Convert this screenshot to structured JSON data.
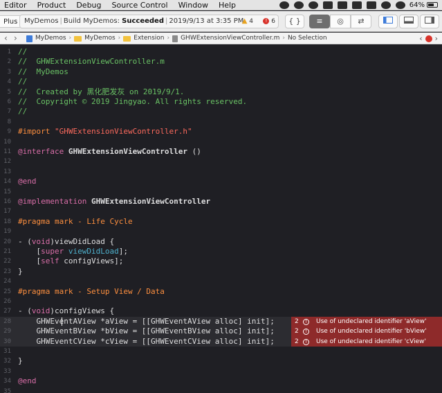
{
  "menubar": {
    "items": [
      "Editor",
      "Product",
      "Debug",
      "Source Control",
      "Window",
      "Help"
    ],
    "battery": "64%"
  },
  "toolbar": {
    "scheme": "Plus",
    "activity": {
      "project": "MyDemos",
      "action": "Build MyDemos:",
      "status": "Succeeded",
      "timestamp": "2019/9/13 at 3:35 PM",
      "warnings": "4",
      "errors": "6"
    },
    "buttons": {
      "braces": "{ }",
      "standard_editor": "≡",
      "assistant_editor": "◎",
      "version_editor": "⇄"
    }
  },
  "jumpbar": {
    "crumbs": [
      "MyDemos",
      "MyDemos",
      "Extension",
      "GHWExtensionViewController.m",
      "No Selection"
    ]
  },
  "editor": {
    "lines": [
      {
        "n": "1",
        "segs": [
          [
            "comment",
            "//"
          ]
        ]
      },
      {
        "n": "2",
        "segs": [
          [
            "comment",
            "//  GHWExtensionViewController.m"
          ]
        ]
      },
      {
        "n": "3",
        "segs": [
          [
            "comment",
            "//  MyDemos"
          ]
        ]
      },
      {
        "n": "4",
        "segs": [
          [
            "comment",
            "//"
          ]
        ]
      },
      {
        "n": "5",
        "segs": [
          [
            "comment",
            "//  Created by 黑化肥发灰 on 2019/9/1."
          ]
        ]
      },
      {
        "n": "6",
        "segs": [
          [
            "comment",
            "//  Copyright © 2019 Jingyao. All rights reserved."
          ]
        ]
      },
      {
        "n": "7",
        "segs": [
          [
            "comment",
            "//"
          ]
        ]
      },
      {
        "n": "8",
        "segs": []
      },
      {
        "n": "9",
        "segs": [
          [
            "preproc",
            "#import "
          ],
          [
            "string",
            "\"GHWExtensionViewController.h\""
          ]
        ]
      },
      {
        "n": "10",
        "segs": []
      },
      {
        "n": "11",
        "segs": [
          [
            "keyword",
            "@interface "
          ],
          [
            "classname",
            "GHWExtensionViewController"
          ],
          [
            "plain",
            " ()"
          ]
        ]
      },
      {
        "n": "12",
        "segs": []
      },
      {
        "n": "13",
        "segs": []
      },
      {
        "n": "14",
        "segs": [
          [
            "keyword",
            "@end"
          ]
        ]
      },
      {
        "n": "15",
        "segs": []
      },
      {
        "n": "16",
        "segs": [
          [
            "keyword",
            "@implementation "
          ],
          [
            "classname",
            "GHWExtensionViewController"
          ]
        ]
      },
      {
        "n": "17",
        "segs": []
      },
      {
        "n": "18",
        "segs": [
          [
            "preproc",
            "#pragma mark - Life Cycle"
          ]
        ]
      },
      {
        "n": "19",
        "segs": []
      },
      {
        "n": "20",
        "segs": [
          [
            "plain",
            "- ("
          ],
          [
            "keyword",
            "void"
          ],
          [
            "plain",
            ")viewDidLoad {"
          ]
        ]
      },
      {
        "n": "21",
        "segs": [
          [
            "plain",
            "    ["
          ],
          [
            "keyword",
            "super "
          ],
          [
            "method",
            "viewDidLoad"
          ],
          [
            "plain",
            "];"
          ]
        ]
      },
      {
        "n": "22",
        "segs": [
          [
            "plain",
            "    ["
          ],
          [
            "keyword",
            "self "
          ],
          [
            "plain",
            "configViews];"
          ]
        ]
      },
      {
        "n": "23",
        "segs": [
          [
            "plain",
            "}"
          ]
        ]
      },
      {
        "n": "24",
        "segs": []
      },
      {
        "n": "25",
        "segs": [
          [
            "preproc",
            "#pragma mark - Setup View / Data"
          ]
        ]
      },
      {
        "n": "26",
        "segs": []
      },
      {
        "n": "27",
        "segs": [
          [
            "plain",
            "- ("
          ],
          [
            "keyword",
            "void"
          ],
          [
            "plain",
            ")configViews {"
          ]
        ]
      },
      {
        "n": "28",
        "hl": true,
        "segs": [
          [
            "plain",
            "    GHWEventAView *aView = [[GHWEventAView alloc] init];"
          ]
        ],
        "error": {
          "count": "2",
          "msg": "Use of undeclared identifier 'aView'"
        }
      },
      {
        "n": "29",
        "hl": true,
        "segs": [
          [
            "plain",
            "    GHWEventBView *bView = [[GHWEventBView alloc] init];"
          ]
        ],
        "error": {
          "count": "2",
          "msg": "Use of undeclared identifier 'bView'"
        }
      },
      {
        "n": "30",
        "hl": true,
        "segs": [
          [
            "plain",
            "    GHWEventCView *cView = [[GHWEventCView alloc] init];"
          ]
        ],
        "error": {
          "count": "2",
          "msg": "Use of undeclared identifier 'cView'"
        }
      },
      {
        "n": "31",
        "segs": []
      },
      {
        "n": "32",
        "segs": [
          [
            "plain",
            "}"
          ]
        ]
      },
      {
        "n": "33",
        "segs": []
      },
      {
        "n": "34",
        "segs": [
          [
            "keyword",
            "@end"
          ]
        ]
      },
      {
        "n": "35",
        "segs": []
      }
    ]
  }
}
